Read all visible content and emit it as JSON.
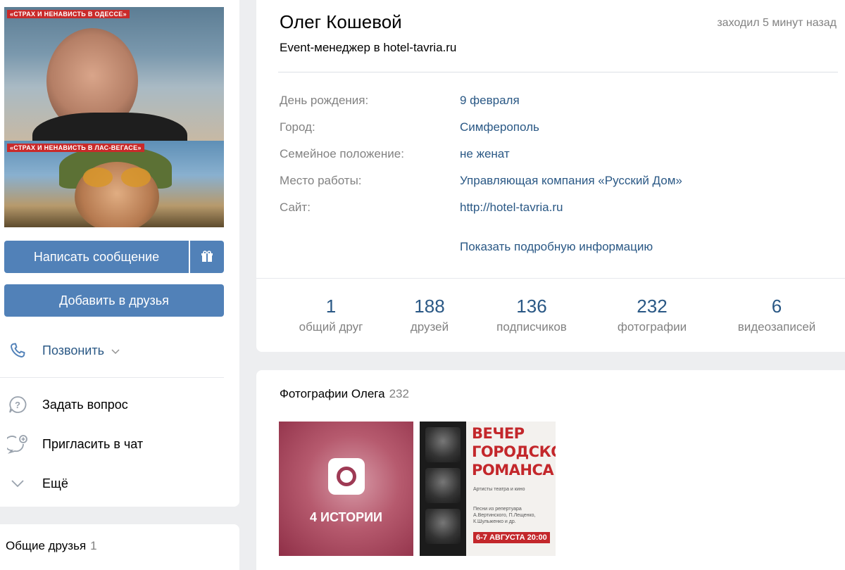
{
  "profile": {
    "name": "Олег Кошевой",
    "status": "Event-менеджер в hotel-tavria.ru",
    "last_seen": "заходил 5 минут назад"
  },
  "avatar": {
    "caption_top": "«СТРАХ И НЕНАВИСТЬ В ОДЕССЕ»",
    "caption_bottom": "«СТРАХ И НЕНАВИСТЬ В ЛАС-ВЕГАСЕ»"
  },
  "actions": {
    "message_label": "Написать сообщение",
    "add_friend_label": "Добавить в друзья",
    "call_label": "Позвонить",
    "ask_label": "Задать вопрос",
    "invite_label": "Пригласить в чат",
    "more_label": "Ещё"
  },
  "info": [
    {
      "label": "День рождения:",
      "value": "9 февраля"
    },
    {
      "label": "Город:",
      "value": "Симферополь"
    },
    {
      "label": "Семейное положение:",
      "value": "не женат"
    },
    {
      "label": "Место работы:",
      "value": "Управляющая компания «Русский Дом»"
    },
    {
      "label": "Сайт:",
      "value": "http://hotel-tavria.ru"
    }
  ],
  "more_info_label": "Показать подробную информацию",
  "stats": [
    {
      "value": "1",
      "label": "общий друг"
    },
    {
      "value": "188",
      "label": "друзей"
    },
    {
      "value": "136",
      "label": "подписчиков"
    },
    {
      "value": "232",
      "label": "фотографии"
    },
    {
      "value": "6",
      "label": "видеозаписей"
    }
  ],
  "photos": {
    "title": "Фотографии Олега",
    "count": "232",
    "stories_label": "4 ИСТОРИИ",
    "poster_title": "ВЕЧЕР ГОРОДСКОГО РОМАНСА",
    "poster_subtitle": "Артисты театра и кино",
    "poster_details": "Песни из репертуара А.Вертинского, П.Лещенко, К.Шульженко и др.",
    "poster_date": "6-7 АВГУСТА 20:00"
  },
  "common_friends": {
    "title": "Общие друзья",
    "count": "1"
  },
  "colors": {
    "primary_button": "#5181b8",
    "link": "#2a5885",
    "secondary_text": "#828282",
    "page_bg": "#edeef0"
  }
}
